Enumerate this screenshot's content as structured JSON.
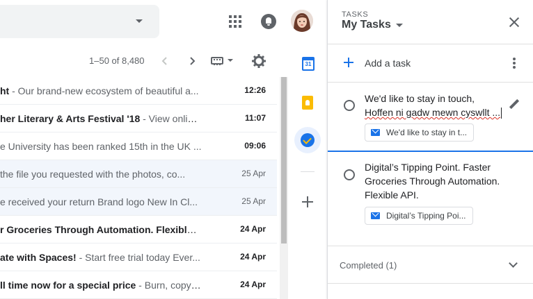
{
  "header": {
    "apps_icon": "apps-grid-icon",
    "notifications_icon": "bell-icon",
    "avatar": "account-avatar"
  },
  "toolbar": {
    "pager": "1–50 of 8,480",
    "prev_icon": "chevron-left-icon",
    "next_icon": "chevron-right-icon",
    "input_tools_icon": "keyboard-icon",
    "settings_icon": "gear-icon"
  },
  "mails": [
    {
      "subject": "ht",
      "snippet": " - Our brand-new ecosystem of beautiful a...",
      "date": "12:26",
      "unread": true
    },
    {
      "subject": "her Literary & Arts Festival '18",
      "snippet": " - View online...",
      "date": "11:07",
      "unread": true
    },
    {
      "subject": "",
      "snippet": "e University has been ranked 15th in the UK ...",
      "date": "09:06",
      "unread": true
    },
    {
      "subject": "",
      "snippet": " the file you requested with the photos, co...",
      "date": "25 Apr",
      "unread": false
    },
    {
      "subject": "",
      "snippet": "e received your return Brand logo New In Cl...",
      "date": "25 Apr",
      "unread": false
    },
    {
      "subject": "r Groceries Through Automation. Flexible ...",
      "snippet": "",
      "date": "24 Apr",
      "unread": true
    },
    {
      "subject": "ate with Spaces!",
      "snippet": " - Start free trial today Ever...",
      "date": "24 Apr",
      "unread": true
    },
    {
      "subject": "ll time now for a special price",
      "snippet": " - Burn, copy a...",
      "date": "24 Apr",
      "unread": true
    }
  ],
  "side_panel": {
    "calendar_day": "31",
    "calendar_icon": "calendar-icon",
    "keep_icon": "keep-icon",
    "tasks_icon": "tasks-icon",
    "addons_icon": "plus-icon"
  },
  "tasks": {
    "label": "TASKS",
    "list_title": "My Tasks",
    "add_task": "Add a task",
    "items": [
      {
        "title": "We'd like to stay in touch,",
        "notes": "Hoffen ni gadw mewn cyswllt ...",
        "chip": "We'd like to stay in t..."
      },
      {
        "title": "Digital’s Tipping Point. Faster Groceries Through Automation. Flexible API.",
        "chip": "Digital’s Tipping Poi..."
      }
    ],
    "completed": "Completed (1)"
  },
  "colors": {
    "accent": "#1a73e8",
    "read_row_bg": "#f2f6fc",
    "spellcheck": "#d93025"
  }
}
